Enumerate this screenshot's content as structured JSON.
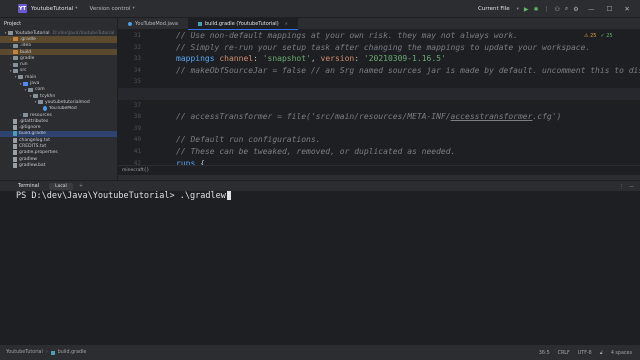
{
  "titlebar": {
    "logo": "YT",
    "project": "YoutubeTutorial",
    "version_control": "Version control",
    "run_config": "Current File"
  },
  "project_panel": {
    "title": "Project",
    "items": [
      {
        "label": "YoutubeTutorial",
        "path": "D:\\dev\\Java\\YoutubeTutorial",
        "arrow": "▾",
        "icon": "folder"
      },
      {
        "label": ".gradle",
        "arrow": "›",
        "icon": "folder-orange",
        "state": "hl"
      },
      {
        "label": ".idea",
        "arrow": "›",
        "icon": "folder"
      },
      {
        "label": "build",
        "arrow": "›",
        "icon": "folder-orange",
        "state": "hl"
      },
      {
        "label": "gradle",
        "arrow": "›",
        "icon": "folder"
      },
      {
        "label": "run",
        "arrow": "›",
        "icon": "folder"
      },
      {
        "label": "src",
        "arrow": "▾",
        "icon": "folder"
      },
      {
        "label": "main",
        "arrow": "▾",
        "icon": "folder"
      },
      {
        "label": "java",
        "arrow": "▾",
        "icon": "folder-blue"
      },
      {
        "label": "com",
        "arrow": "▾",
        "icon": "folder"
      },
      {
        "label": "tcykhn",
        "arrow": "▾",
        "icon": "folder"
      },
      {
        "label": "youtubetutorialmod",
        "arrow": "▾",
        "icon": "folder"
      },
      {
        "label": "YouTubeMod",
        "arrow": "",
        "icon": "java"
      },
      {
        "label": "resources",
        "arrow": "›",
        "icon": "folder"
      },
      {
        "label": ".gitattributes",
        "arrow": "",
        "icon": "file"
      },
      {
        "label": ".gitignore",
        "arrow": "",
        "icon": "file"
      },
      {
        "label": "build.gradle",
        "arrow": "",
        "icon": "gradle",
        "state": "sel"
      },
      {
        "label": "changelog.txt",
        "arrow": "",
        "icon": "file"
      },
      {
        "label": "CREDITS.txt",
        "arrow": "",
        "icon": "file"
      },
      {
        "label": "gradle.properties",
        "arrow": "",
        "icon": "file"
      },
      {
        "label": "gradlew",
        "arrow": "",
        "icon": "file"
      },
      {
        "label": "gradlew.bat",
        "arrow": "",
        "icon": "file"
      }
    ]
  },
  "tabs": [
    {
      "label": "YouTubeMod.java",
      "icon": "java",
      "active": false
    },
    {
      "label": "build.gradle (YoutubeTutorial)",
      "icon": "gradle",
      "active": true
    }
  ],
  "editor": {
    "line_numbers": [
      "31",
      "32",
      "33",
      "34",
      "35",
      "36",
      "37",
      "38",
      "39",
      "40",
      "41",
      "42"
    ],
    "current_line": "36",
    "inspections": {
      "warnings": "⚠ 25",
      "ok": "✓ 25"
    },
    "breadcrumb": "minecraft{}"
  },
  "terminal": {
    "title": "Terminal",
    "tab": "Local",
    "add": "+",
    "prompt": "PS D:\\dev\\Java\\YoutubeTutorial> ",
    "command": ".\\gradlew"
  },
  "statusbar": {
    "crumbs": [
      "YoutubeTutorial",
      "build.gradle"
    ],
    "position": "36:5",
    "line_sep": "CRLF",
    "encoding": "UTF-8",
    "indent": "4 spaces"
  },
  "colors": {
    "bg": "#1e1f22",
    "panel": "#2b2d30",
    "comment": "#7a7e85",
    "keyword": "#cf8e6d",
    "string": "#6aab73",
    "accent": "#3574f0"
  }
}
